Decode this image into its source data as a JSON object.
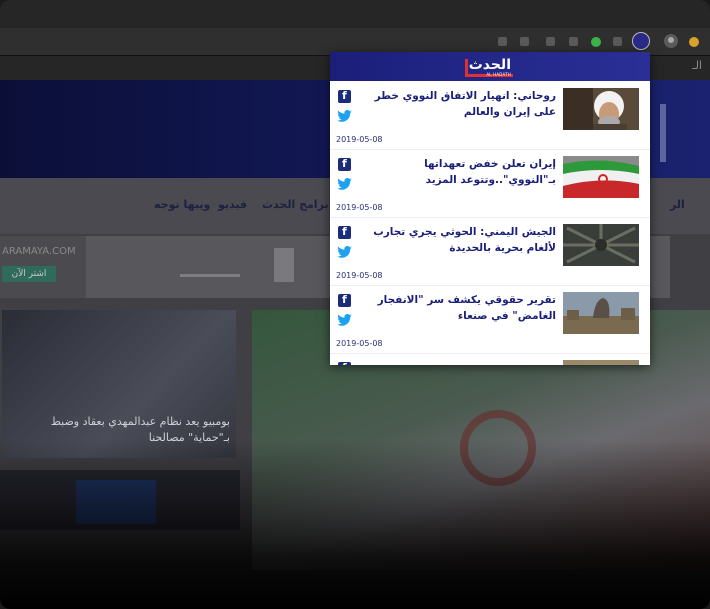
{
  "browser": {
    "bookmarks_fragment": "الـ"
  },
  "website": {
    "nav": {
      "items": [
        "برامج الحدث",
        "فيديو",
        "ويبها توجه"
      ],
      "left_fragment": "الر"
    },
    "ad": {
      "url": "ARAMAYA.COM",
      "button": "اشتر الآن"
    },
    "hero_caption": "بومبيو يعد نظام عبدالمهدي بعقاد وضبط بـ\"حماية\" مصالحنا"
  },
  "popup": {
    "logo_text": "الحدث",
    "logo_sub": "AL HADATH",
    "colors": {
      "header": "#1b1f7a",
      "title": "#1a1f7a",
      "accent": "#e03030"
    },
    "news": [
      {
        "title": "روحاني: انهيار الاتفاق النووي خطر على إيران والعالم",
        "date": "2019-05-08",
        "thumb": "rouhani-photo"
      },
      {
        "title": "إيران تعلن خفض تعهداتها بـ\"النووي\"..وتتوعد المزيد",
        "date": "2019-05-08",
        "thumb": "iran-flag-photo"
      },
      {
        "title": "الجيش اليمني: الحوثي يجري تجارب لألغام بحرية بالحديدة",
        "date": "2019-05-08",
        "thumb": "sea-mines-photo"
      },
      {
        "title": "تقرير حقوقي يكشف سر \"الانفجار الغامض\" في صنعاء",
        "date": "2019-05-08",
        "thumb": "sanaa-explosion-photo"
      },
      {
        "title": "",
        "date": "",
        "thumb": "partial-photo"
      }
    ]
  }
}
